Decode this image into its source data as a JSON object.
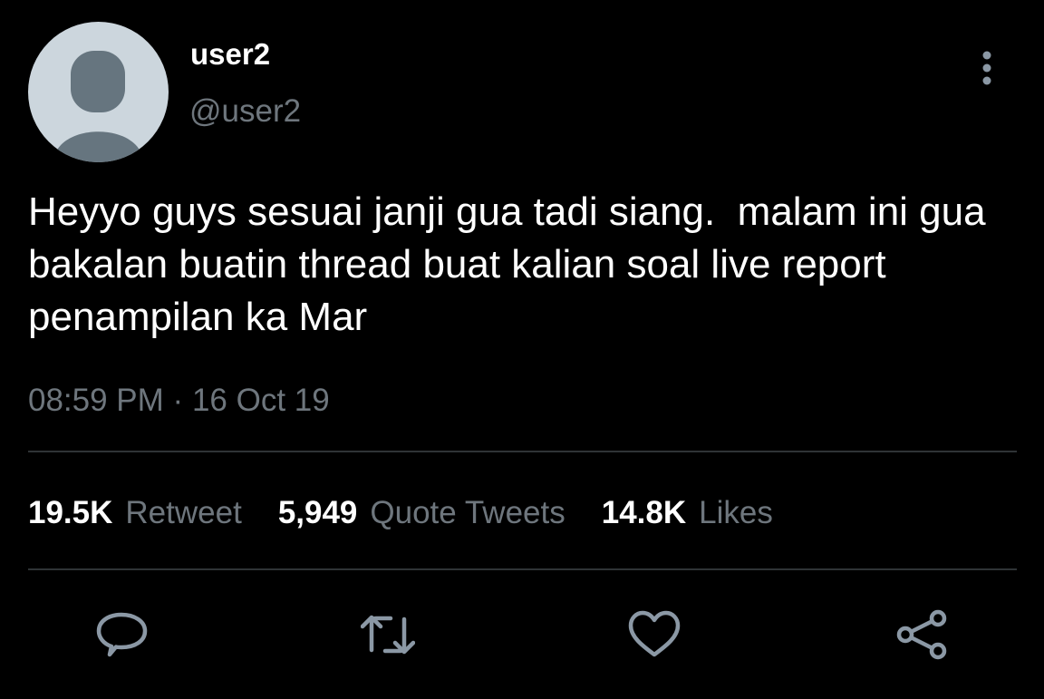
{
  "user": {
    "display_name": "user2",
    "handle": "@user2"
  },
  "tweet": {
    "text": "Heyyo guys sesuai janji gua tadi siang.  malam ini gua bakalan buatin thread buat kalian soal live report penampilan ka Mar",
    "time": "08:59 PM",
    "separator": "·",
    "date": "16 Oct 19"
  },
  "stats": {
    "retweets": {
      "count": "19.5K",
      "label": "Retweet"
    },
    "quotes": {
      "count": "5,949",
      "label": "Quote Tweets"
    },
    "likes": {
      "count": "14.8K",
      "label": "Likes"
    }
  },
  "icons": {
    "avatar": "default-avatar-icon",
    "more": "more-vertical-icon",
    "reply": "reply-icon",
    "retweet": "retweet-icon",
    "like": "heart-icon",
    "share": "share-icon"
  },
  "colors": {
    "background": "#000000",
    "primary_text": "#ffffff",
    "secondary_text": "#6e767d",
    "divider": "#2f3336",
    "icon": "#8b98a5",
    "avatar_bg": "#ccd6dd",
    "avatar_figure": "#66757f"
  }
}
